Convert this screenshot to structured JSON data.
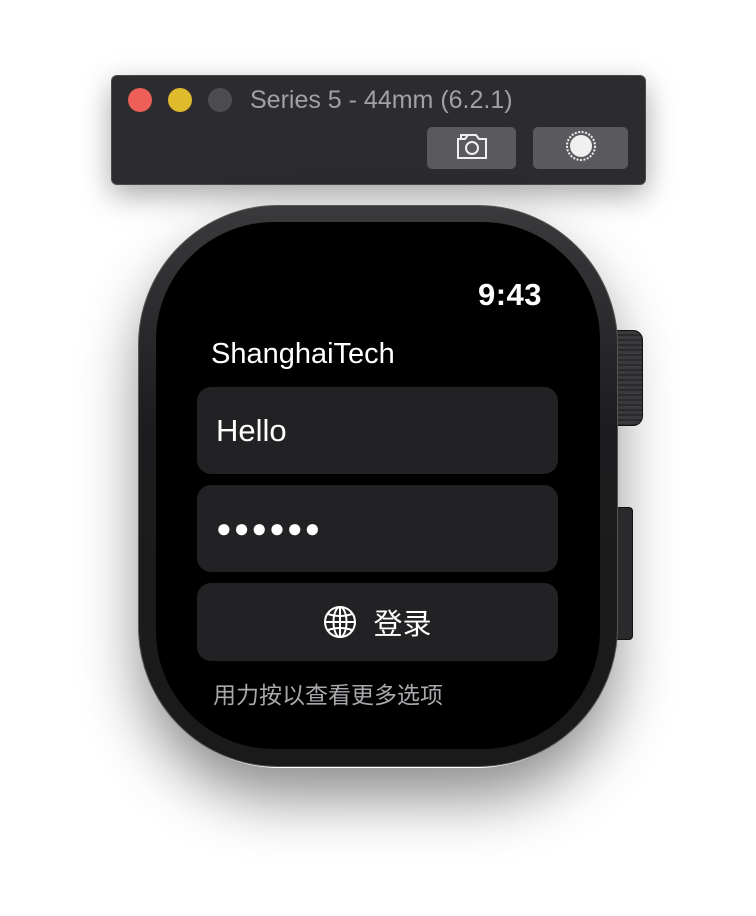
{
  "window": {
    "title": "Series 5 - 44mm (6.2.1)",
    "buttons": {
      "close_icon": "close-icon",
      "minimize_icon": "minimize-icon",
      "zoom_icon": "zoom-icon",
      "screenshot_icon": "camera-icon",
      "home_icon": "home-button-icon"
    }
  },
  "watch": {
    "status": {
      "time": "9:43"
    },
    "app_title": "ShanghaiTech",
    "username_field": {
      "value": "Hello"
    },
    "password_field": {
      "value": "●●●●●●"
    },
    "login_button": {
      "label": "登录",
      "icon": "globe-icon"
    },
    "hint": "用力按以查看更多选项"
  },
  "colors": {
    "close": "#ed5f57",
    "minimize": "#e0ba2d",
    "zoom_disabled": "#4d4d50",
    "screen_bg": "#000000",
    "field_bg": "#222224",
    "hint_text": "#a8a8ad"
  }
}
